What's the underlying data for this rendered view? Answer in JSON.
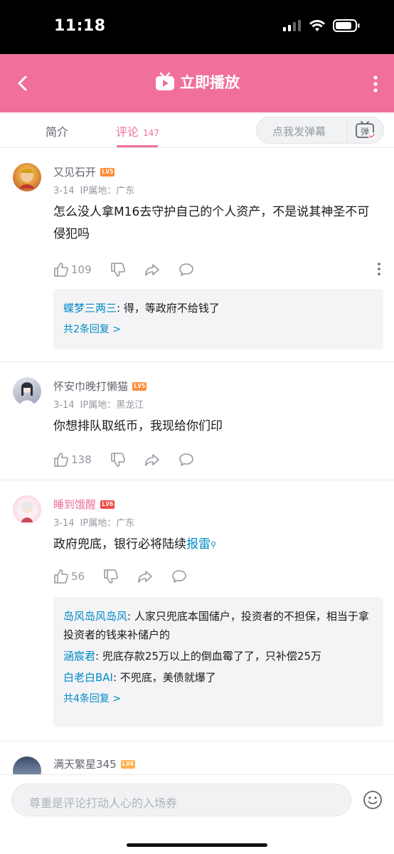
{
  "status_bar": {
    "time": "11:18"
  },
  "header": {
    "title": "立即播放",
    "back_icon": "back-icon",
    "play_icon": "tv-play-icon",
    "more_icon": "more-vertical-icon",
    "color": "#f07099"
  },
  "tabs": [
    {
      "label": "简介"
    },
    {
      "label": "评论",
      "count": "147"
    }
  ],
  "danmaku": {
    "placeholder": "点我发弹幕",
    "button_icon": "danmaku-toggle-icon",
    "button_glyph": "弹"
  },
  "comments": [
    {
      "user": "又见石开",
      "level": "LV5",
      "date": "3-14",
      "ip": "IP属地：广东",
      "text": "怎么没人拿M16去守护自己的个人资产，不是说其神圣不可侵犯吗",
      "likes": "109",
      "replies": [
        {
          "name": "蝶梦三两三",
          "text": ": 得，等政府不给钱了"
        }
      ],
      "more": "共2条回复 >"
    },
    {
      "user": "怀安巾晚打懒猫",
      "level": "LV5",
      "date": "3-14",
      "ip": "IP属地：黑龙江",
      "text": "你想排队取纸币，我现给你们印",
      "likes": "138"
    },
    {
      "user": "睡到饿醒",
      "level": "LV6",
      "date": "3-14",
      "ip": "IP属地：广东",
      "text_before": "政府兜底，银行必将陆续",
      "keyword": "报雷",
      "likes": "56",
      "replies": [
        {
          "name": "岛风岛风岛风",
          "text": ": 人家只兜底本国储户，投资者的不担保，相当于拿投资者的钱来补储户的"
        },
        {
          "name": "涵宸君",
          "text": ": 兜底存款25万以上的倒血霉了了，只补偿25万"
        },
        {
          "name": "白老白BAI",
          "text": ": 不兜底，美债就爆了"
        }
      ],
      "more": "共4条回复 >"
    },
    {
      "user": "满天繁星345",
      "level": "LV4"
    }
  ],
  "bottom_bar": {
    "placeholder": "尊重是评论打动人心的入场券",
    "emoji_icon": "emoji-icon"
  }
}
